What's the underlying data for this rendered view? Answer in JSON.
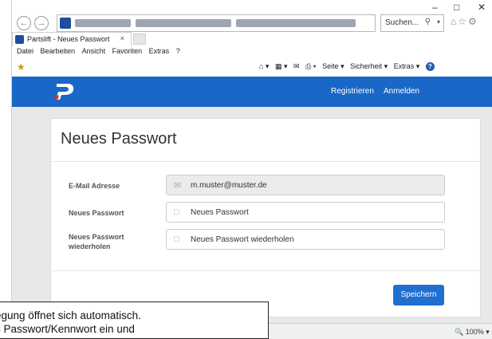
{
  "browser": {
    "window_controls": [
      "–",
      "□",
      "✕"
    ],
    "search_placeholder": "Suchen...",
    "tab_title": "Partslift - Neues Passwort",
    "tab_close": "×",
    "menu": [
      "Datei",
      "Bearbeiten",
      "Ansicht",
      "Favoriten",
      "Extras",
      "?"
    ],
    "command_bar": [
      "Seite ▾",
      "Sicherheit ▾",
      "Extras ▾"
    ],
    "zoom": "100%"
  },
  "header": {
    "links": [
      "Registrieren",
      "Anmelden"
    ],
    "background": "#1967c6"
  },
  "form": {
    "title": "Neues Passwort",
    "email_label": "E-Mail Adresse",
    "email_value": "m.muster@muster.de",
    "password_label": "Neues Passwort",
    "password_placeholder": "Neues Passwort",
    "repeat_label_line1": "Neues Passwort",
    "repeat_label_line2": "wiederholen",
    "repeat_placeholder": "Neues Passwort wiederholen",
    "save_label": "Speichern"
  },
  "caption": {
    "line1": "egung öffnet sich automatisch.",
    "line2": "s Passwort/Kennwort ein und"
  }
}
